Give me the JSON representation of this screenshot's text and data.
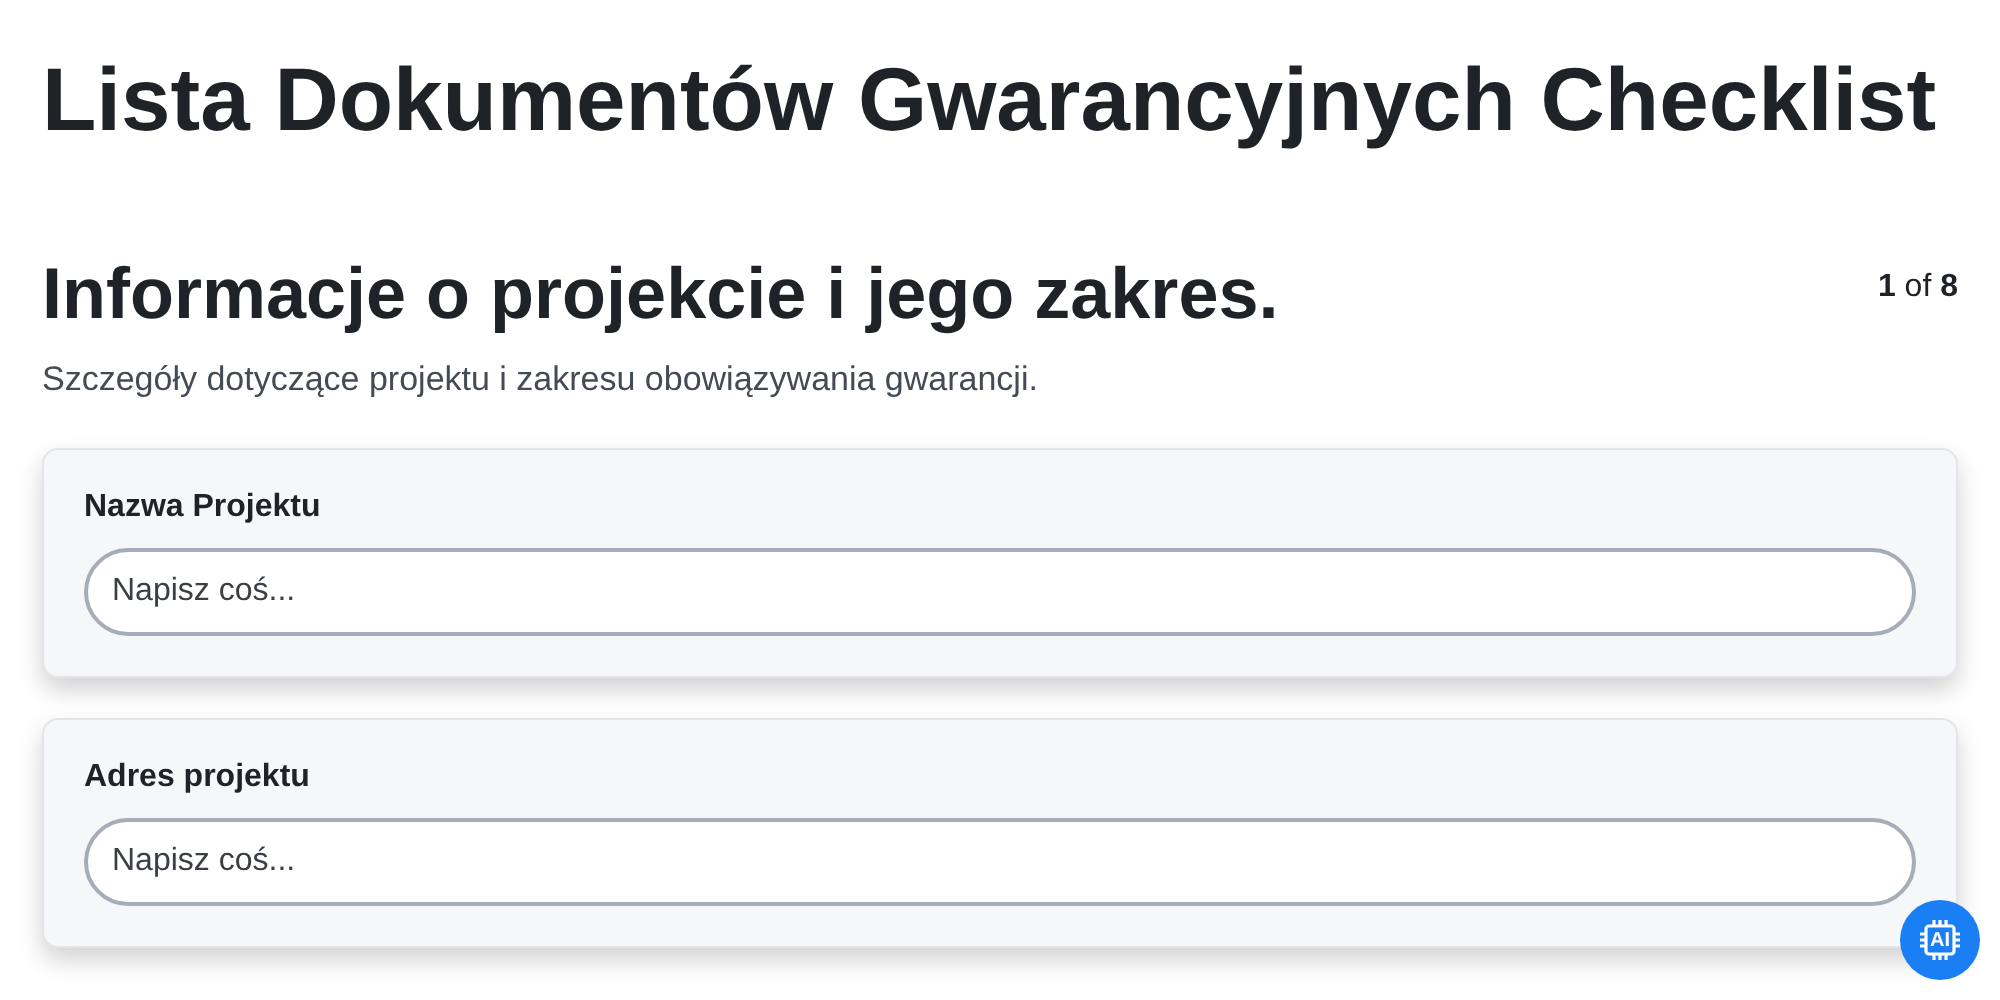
{
  "title": "Lista Dokumentów Gwarancyjnych Checklist",
  "section": {
    "title": "Informacje o projekcie i jego zakres.",
    "pager": "**1** of **8**",
    "description": "Szczegóły dotyczące projektu i zakresu obowiązywania gwarancji."
  },
  "fields": [
    {
      "label": "Nazwa Projektu",
      "placeholder": "Napisz coś..."
    },
    {
      "label": "Adres projektu",
      "placeholder": "Napisz coś..."
    }
  ],
  "ai_button": {
    "label": "AI"
  }
}
